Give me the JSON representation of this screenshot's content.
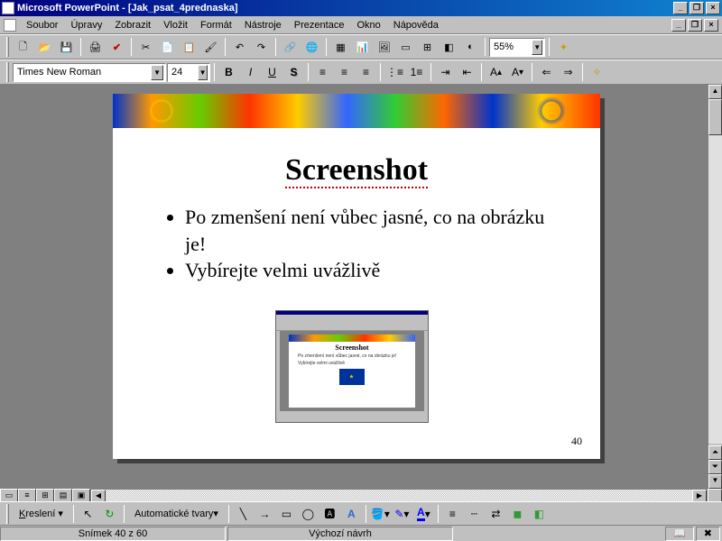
{
  "app": {
    "name": "Microsoft PowerPoint",
    "doc": "[Jak_psat_4prednaska]"
  },
  "menu": [
    "Soubor",
    "Úpravy",
    "Zobrazit",
    "Vložit",
    "Formát",
    "Nástroje",
    "Prezentace",
    "Okno",
    "Nápověda"
  ],
  "toolbar1": {
    "zoom": "55%"
  },
  "toolbar2": {
    "font": "Times New Roman",
    "size": "24"
  },
  "slide": {
    "title": "Screenshot",
    "bullets": [
      "Po zmenšení není vůbec jasné, co na obrázku je!",
      "Vybírejte velmi uvážlivě"
    ],
    "number": "40",
    "mini_title": "Screenshot",
    "mini_b1": "Po zmenšení není vůbec jasné, co na obrázku je!",
    "mini_b2": "Vybírejte velmi uvážlivě"
  },
  "drawbar": {
    "draw": "Kreslení",
    "autoshapes": "Automatické tvary"
  },
  "status": {
    "slide": "Snímek 40 z 60",
    "design": "Výchozí návrh"
  }
}
